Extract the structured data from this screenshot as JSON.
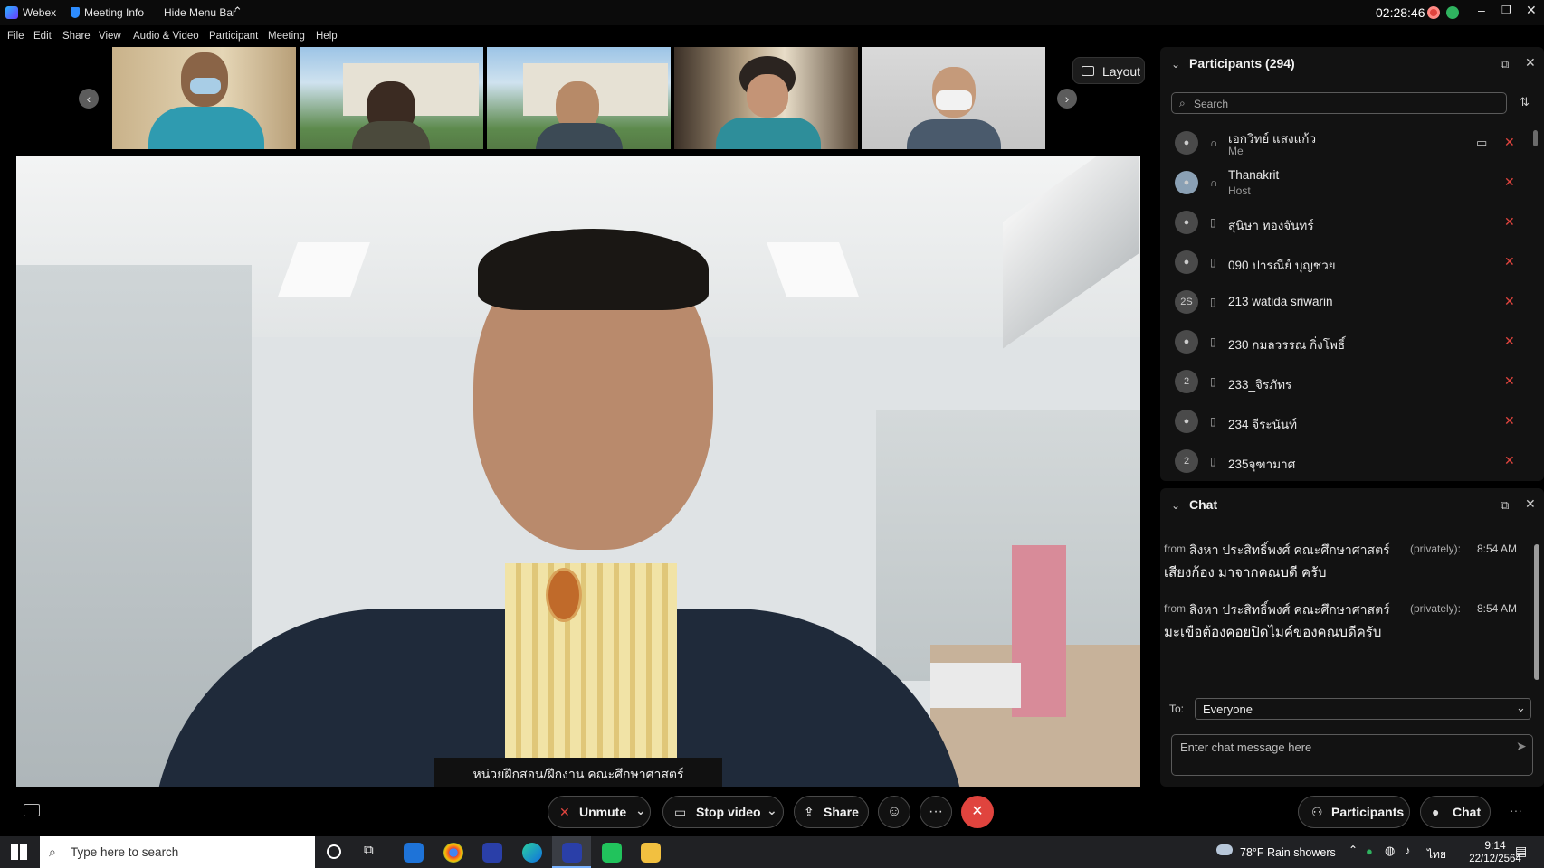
{
  "titlebar": {
    "app_name": "Webex",
    "meeting_info": "Meeting Info",
    "hide_menu": "Hide Menu Bar",
    "clock": "02:28:46"
  },
  "menu": [
    "File",
    "Edit",
    "Share",
    "View",
    "Audio & Video",
    "Participant",
    "Meeting",
    "Help"
  ],
  "layout_button": "Layout",
  "caption": "หน่วยฝึกสอน/ฝึกงาน คณะศึกษาศาสตร์",
  "participants": {
    "title": "Participants (294)",
    "search_placeholder": "Search",
    "rows": [
      {
        "name": "เอกวิทย์ แสงแก้ว",
        "sub": "Me"
      },
      {
        "name": "Thanakrit",
        "sub": "Host"
      },
      {
        "name": "สุนิษา ทองจันทร์",
        "sub": ""
      },
      {
        "name": "090 ปารณีย์ บุญช่วย",
        "sub": ""
      },
      {
        "name": "213 watida sriwarin",
        "sub": "",
        "initials": "2S"
      },
      {
        "name": "230 กมลวรรณ กิ่งโพธิ์",
        "sub": ""
      },
      {
        "name": "233_จิรภัทร",
        "sub": "",
        "initials": "2"
      },
      {
        "name": "234 จีระนันท์",
        "sub": ""
      },
      {
        "name": "235จุฑามาศ",
        "sub": "",
        "initials": "2"
      }
    ]
  },
  "chat": {
    "title": "Chat",
    "messages": [
      {
        "from_prefix": "from",
        "sender": "สิงหา ประสิทธิ์พงศ์ คณะศึกษาศาสตร์",
        "privately": "(privately):",
        "time": "8:54 AM",
        "text": "เสียงก้อง มาจากคณบดี ครับ"
      },
      {
        "from_prefix": "from",
        "sender": "สิงหา ประสิทธิ์พงศ์ คณะศึกษาศาสตร์",
        "privately": "(privately):",
        "time": "8:54 AM",
        "text": "มะเขือต้องคอยปิดไมค์ของคณบดีครับ"
      }
    ],
    "to_label": "To:",
    "to_value": "Everyone",
    "input_placeholder": "Enter chat message here"
  },
  "toolbar": {
    "unmute": "Unmute",
    "stop_video": "Stop video",
    "share": "Share",
    "participants": "Participants",
    "chat": "Chat"
  },
  "taskbar": {
    "search_placeholder": "Type here to search",
    "weather": "78°F  Rain showers",
    "lang": "ไทย",
    "time": "9:14",
    "date": "22/12/2564"
  },
  "colors": {
    "danger": "#e0443e",
    "panel": "#121212",
    "accent": "#2d8cff"
  }
}
